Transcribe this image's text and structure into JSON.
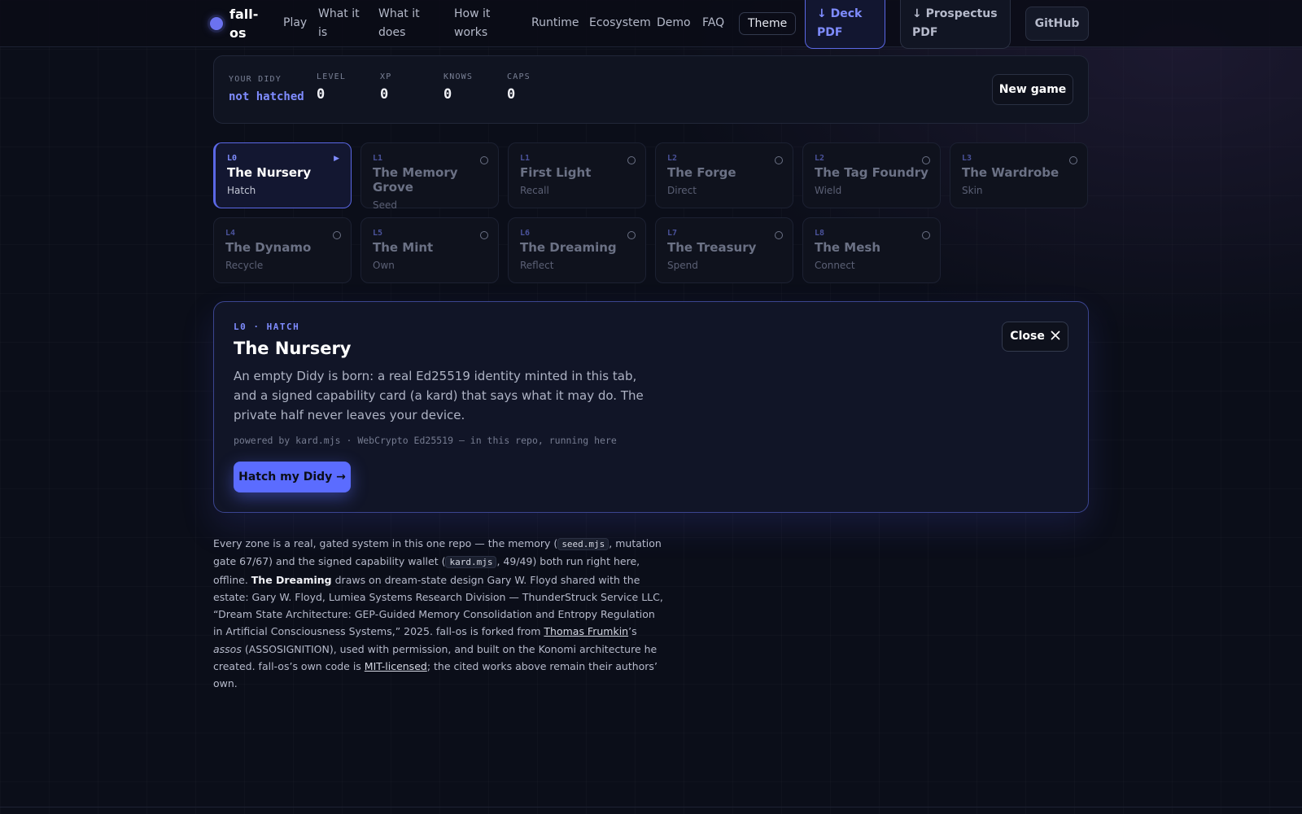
{
  "nav": {
    "brand": "fall-os",
    "links": [
      "Play",
      "What it is",
      "What it does",
      "How it works",
      "Runtime",
      "Ecosystem",
      "Demo",
      "FAQ"
    ],
    "theme": "Theme",
    "deck_pdf": "↓ Deck PDF",
    "prospectus_pdf": "↓ Prospectus PDF",
    "github": "GitHub"
  },
  "status": {
    "didy_label": "YOUR DIDY",
    "didy_value": "not hatched",
    "level_label": "LEVEL",
    "level_value": "0",
    "xp_label": "XP",
    "xp_value": "0",
    "knows_label": "KNOWS",
    "knows_value": "0",
    "caps_label": "CAPS",
    "caps_value": "0",
    "new_game": "New game"
  },
  "zones": [
    {
      "level": "L0",
      "title": "The Nursery",
      "verb": "Hatch",
      "active": true
    },
    {
      "level": "L1",
      "title": "The Memory Grove",
      "verb": "Seed"
    },
    {
      "level": "L1",
      "title": "First Light",
      "verb": "Recall"
    },
    {
      "level": "L2",
      "title": "The Forge",
      "verb": "Direct"
    },
    {
      "level": "L2",
      "title": "The Tag Foundry",
      "verb": "Wield"
    },
    {
      "level": "L3",
      "title": "The Wardrobe",
      "verb": "Skin"
    },
    {
      "level": "L4",
      "title": "The Dynamo",
      "verb": "Recycle"
    },
    {
      "level": "L5",
      "title": "The Mint",
      "verb": "Own"
    },
    {
      "level": "L6",
      "title": "The Dreaming",
      "verb": "Reflect"
    },
    {
      "level": "L7",
      "title": "The Treasury",
      "verb": "Spend"
    },
    {
      "level": "L8",
      "title": "The Mesh",
      "verb": "Connect"
    }
  ],
  "panel": {
    "kicker": "L0 · HATCH",
    "title": "The Nursery",
    "description": "An empty Didy is born: a real Ed25519 identity minted in this tab, and a signed capability card (a kard) that says what it may do. The private half never leaves your device.",
    "powered": "powered by kard.mjs · WebCrypto Ed25519 — in this repo, running here",
    "hatch_button": "Hatch my Didy →",
    "close_button": "Close"
  },
  "footer": {
    "t1": "Every zone is a real, gated system in this one repo — the memory (",
    "code1": "seed.mjs",
    "t2": ", mutation gate 67/67) and the signed capability wallet (",
    "code2": "kard.mjs",
    "t3": ", 49/49) both run right here, offline. ",
    "bold1": "The Dreaming",
    "t4": " draws on dream-state design Gary W. Floyd shared with the estate: Gary W. Floyd, Lumiea Systems Research Division — ThunderStruck Service LLC, “Dream State Architecture: GEP-Guided Memory Consolidation and Entropy Regulation in Artificial Consciousness Systems,” 2025. fall-os is forked from ",
    "link1": "Thomas Frumkin",
    "t5": "’s ",
    "italic1": "assos",
    "t6": " (ASSOSIGNITION), used with permission, and built on the Konomi architecture he created. fall-os’s own code is ",
    "link2": "MIT-licensed",
    "t7": "; the cited works above remain their authors’ own."
  }
}
